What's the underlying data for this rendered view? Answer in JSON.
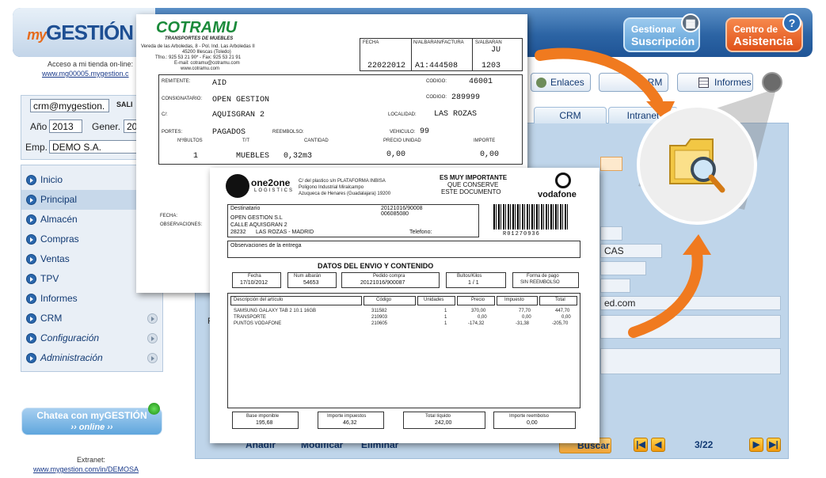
{
  "header": {
    "logo_prefix": "my",
    "logo_main": "GESTIÓN",
    "suscripcion_line1": "Gestionar",
    "suscripcion_line2": "Suscripción",
    "asistencia_line1": "Centro de",
    "asistencia_line2": "Asistencia",
    "help_glyph": "?"
  },
  "store": {
    "access_text": "Acceso a mi tienda on-line:",
    "access_link": "www.mg00005.mygestion.c"
  },
  "user": {
    "email": "crm@mygestion.",
    "logout_label": "SALI",
    "year_label": "Año",
    "year_value": "2013",
    "gener_label": "Gener.",
    "gener_value": "20",
    "emp_label": "Emp.",
    "emp_value": "DEMO S.A."
  },
  "menu": {
    "items": [
      {
        "label": "Inicio",
        "active": false,
        "italic": false
      },
      {
        "label": "Principal",
        "active": true,
        "italic": false
      },
      {
        "label": "Almacén",
        "active": false,
        "italic": false
      },
      {
        "label": "Compras",
        "active": false,
        "italic": false
      },
      {
        "label": "Ventas",
        "active": false,
        "italic": false
      },
      {
        "label": "TPV",
        "active": false,
        "italic": false
      },
      {
        "label": "Informes",
        "active": false,
        "italic": false
      },
      {
        "label": "CRM",
        "active": false,
        "italic": false
      },
      {
        "label": "Configuración",
        "active": false,
        "italic": true
      },
      {
        "label": "Administración",
        "active": false,
        "italic": true
      }
    ]
  },
  "chat": {
    "line1": "Chatea con myGESTIÓN",
    "line2": "›› online ››"
  },
  "extranet": {
    "label": "Extranet:",
    "link": "www.mygestion.com/in/DEMOSA"
  },
  "toolbar": {
    "enlaces": "Enlaces",
    "crm": "CRM",
    "informes": "Informes"
  },
  "tabs": {
    "crm": "CRM",
    "intranet": "Intranet"
  },
  "form": {
    "field_cas": "CAS",
    "field_email": "ed.com"
  },
  "actions": {
    "anadir": "Añadir",
    "modificar": "Modificar",
    "eliminar": "Eliminar",
    "buscar": "Buscar",
    "page": "3/22"
  },
  "cotramu": {
    "brand": "COTRAMU",
    "subtitle": "TRANSPORTES DE MUEBLES",
    "addr1": "Vereda de las Arboledas, 8 - Pol. Ind. Las Arboledas II",
    "addr2": "45200 Illescas (Toledo)",
    "addr3": "Tfno.: 925 53 21 90* - Fax: 925 53 21 91",
    "addr4": "E-mail: cotramu@cotramu.com",
    "addr5": "www.cotramu.com",
    "fecha_label": "FECHA",
    "albaran_label": "N/ALBARAN/FACTURA",
    "salbaran_label": "S/ALBARAN",
    "salbaran_top": "JU",
    "fecha_value": "22022012",
    "albaran_value": "A1:444508",
    "salbaran_value": "1203",
    "remitente_label": "REMITENTE:",
    "remitente_value": "AID",
    "codigo_label": "CODIGO:",
    "codigo1_value": "46001",
    "consignatario_label": "CONSIGNATARIO:",
    "consignatario_value": "OPEN GESTION",
    "codigo2_value": "289999",
    "c_label": "C/:",
    "c_value": "AQUISGRAN 2",
    "localidad_label": "LOCALIDAD:",
    "localidad_value": "LAS ROZAS",
    "portes_label": "PORTES:",
    "portes_value": "PAGADOS",
    "reembolso_label": "REEMBOLSO:",
    "vehiculo_label": "VEHICULO:",
    "vehiculo_value": "99",
    "col_bultos": "Nº/BULTOS",
    "col_tt": "T/T",
    "col_cantidad": "CANTIDAD",
    "col_precio": "PRECIO UNIDAD",
    "col_importe": "IMPORTE",
    "row_bultos": "1",
    "row_tt": "MUEBLES",
    "row_cantidad": "0,32m3",
    "row_precio": "0,00",
    "row_importe": "0,00",
    "fecha2_label": "FECHA:",
    "observaciones_label": "OBSERVACIONES:"
  },
  "vodafone": {
    "logistics_line1": "one2one",
    "logistics_line2": "LOGISTICS",
    "addr1": "C/ del plastico s/n PLATAFORMA INBISA",
    "addr2": "Poligono Industrial Miralcampo",
    "addr3": "Azuqueca de Henares (Guadalajara) 19200",
    "notice1": "ES MUY IMPORTANTE",
    "notice2": "QUE CONSERVE",
    "notice3": "ESTE DOCUMENTO",
    "brand": "vodafone",
    "dest_label": "Destinatario",
    "dest_ref1": "20121016/90008",
    "dest_ref2": "006085080",
    "dest_name": "OPEN GESTION S.L",
    "dest_street": "CALLE AQUISGRAN 2",
    "dest_zip": "28232",
    "dest_city": "LAS ROZAS - MADRID",
    "telefono_label": "Telefono:",
    "barcode_text": "R01270936",
    "obs_label": "Observaciones de la entrega",
    "section_title": "DATOS DEL ENVIO Y CONTENIDO",
    "fecha_label": "Fecha",
    "fecha_value": "17/10/2012",
    "num_label": "Num albarán",
    "num_value": "54653",
    "pedido_label": "Pedido compra",
    "pedido_value": "20121016/900087",
    "bultos_label": "Bultos/Kilos",
    "bultos_value": "1 / 1",
    "pago_label": "Forma de pago",
    "pago_value": "SIN REEMBOLSO",
    "col_desc": "Descripción del artículo",
    "col_codigo": "Código",
    "col_unidades": "Unidades",
    "col_precio": "Precio",
    "col_impuesto": "Impuesto",
    "col_total": "Total",
    "rows": [
      {
        "desc": "SAMSUNG GALAXY TAB 2 10.1 16GB",
        "codigo": "311582",
        "unidades": "1",
        "precio": "370,00",
        "impuesto": "77,70",
        "total": "447,70"
      },
      {
        "desc": "TRANSPORTE",
        "codigo": "210903",
        "unidades": "1",
        "precio": "0,00",
        "impuesto": "0,00",
        "total": "0,00"
      },
      {
        "desc": "PUNTOS VODAFONE",
        "codigo": "210605",
        "unidades": "1",
        "precio": "-174,32",
        "impuesto": "-31,38",
        "total": "-205,70"
      }
    ],
    "base_label": "Base imponible",
    "base_value": "195,68",
    "impuestos_label": "Importe impuestos",
    "impuestos_value": "46,32",
    "total_label": "Total líquido",
    "total_value": "242,00",
    "reembolso_label": "Importe reembolso",
    "reembolso_value": "0,00"
  }
}
